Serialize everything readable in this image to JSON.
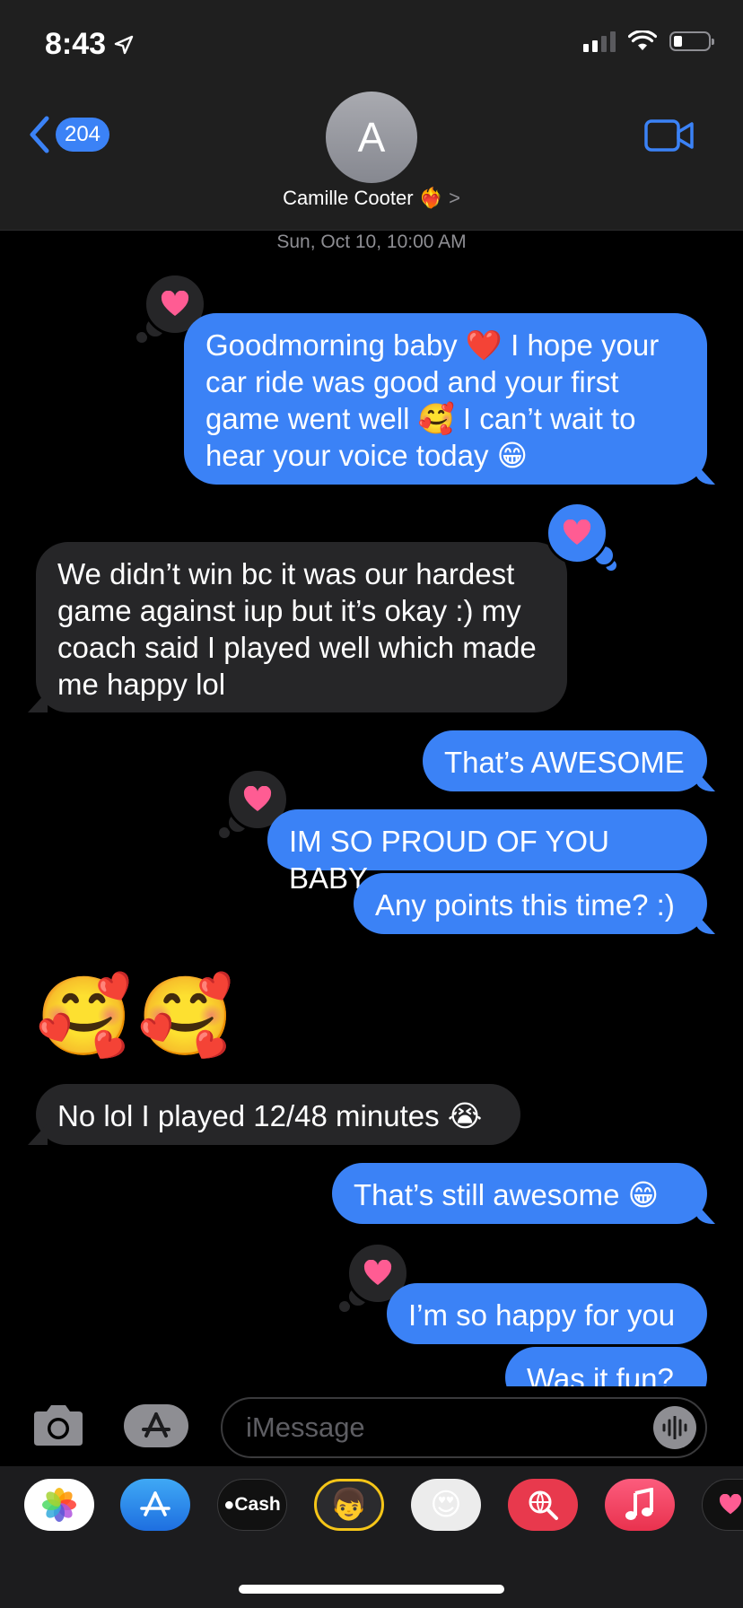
{
  "status": {
    "time": "8:43"
  },
  "header": {
    "back_count": "204",
    "avatar_initial": "A",
    "contact_name": "Camille Cooter ❤️‍🔥",
    "chevron": ">"
  },
  "conversation": {
    "timestamp": "Sun, Oct 10, 10:00 AM",
    "messages": [
      {
        "from": "me",
        "text": "Goodmorning baby ❤️ I hope your car ride was good and your first game went well 🥰 I can’t wait to hear your voice today 😁",
        "reaction": "heart"
      },
      {
        "from": "them",
        "text": "We didn’t win bc it was our hardest game against iup but it’s okay :) my coach said I played well which made me happy lol",
        "reaction": "heart"
      },
      {
        "from": "me",
        "text": "That’s AWESOME"
      },
      {
        "from": "me",
        "text": "IM SO PROUD OF YOU BABY",
        "reaction": "heart"
      },
      {
        "from": "me",
        "text": "Any points this time? :)"
      },
      {
        "from": "them",
        "text": "🥰🥰"
      },
      {
        "from": "them",
        "text": "No lol I played 12/48 minutes 😭"
      },
      {
        "from": "me",
        "text": "That’s still awesome 😁"
      },
      {
        "from": "me",
        "text": "I’m so happy for you",
        "reaction": "heart"
      },
      {
        "from": "me",
        "text": "Was it fun?"
      }
    ]
  },
  "compose": {
    "placeholder": "iMessage"
  },
  "drawer": {
    "cash_label": "Cash"
  },
  "colors": {
    "sent_bubble": "#3b82f6",
    "received_bubble": "#262628",
    "reaction_heart": "#ff5c93"
  }
}
